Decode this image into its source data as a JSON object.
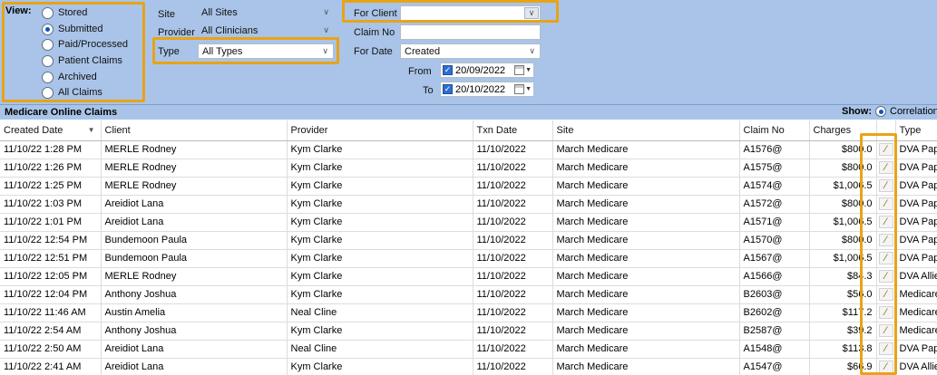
{
  "view": {
    "label": "View:",
    "options": [
      "Stored",
      "Submitted",
      "Paid/Processed",
      "Patient Claims",
      "Archived",
      "All Claims"
    ],
    "selected": "Submitted"
  },
  "filters": {
    "site_label": "Site",
    "site_value": "All Sites",
    "provider_label": "Provider",
    "provider_value": "All Clinicians",
    "type_label": "Type",
    "type_value": "All Types",
    "for_client_label": "For Client",
    "for_client_value": "",
    "claim_no_label": "Claim No",
    "claim_no_value": "",
    "for_date_label": "For Date",
    "for_date_value": "Created",
    "from_label": "From",
    "from_value": "20/09/2022",
    "to_label": "To",
    "to_value": "20/10/2022"
  },
  "section": {
    "title": "Medicare Online Claims",
    "show_label": "Show:",
    "show_option": "Correlation"
  },
  "table": {
    "columns": [
      "Created Date",
      "Client",
      "Provider",
      "Txn Date",
      "Site",
      "Claim No",
      "Charges",
      "",
      "Type"
    ],
    "rows": [
      [
        "11/10/22 1:28 PM",
        "MERLE Rodney",
        "Kym Clarke",
        "11/10/2022",
        "March Medicare",
        "A1576@",
        "$800.0",
        "DVA Pape"
      ],
      [
        "11/10/22 1:26 PM",
        "MERLE Rodney",
        "Kym Clarke",
        "11/10/2022",
        "March Medicare",
        "A1575@",
        "$800.0",
        "DVA Pape"
      ],
      [
        "11/10/22 1:25 PM",
        "MERLE Rodney",
        "Kym Clarke",
        "11/10/2022",
        "March Medicare",
        "A1574@",
        "$1,006.5",
        "DVA Pape"
      ],
      [
        "11/10/22 1:03 PM",
        "Areidiot Lana",
        "Kym Clarke",
        "11/10/2022",
        "March Medicare",
        "A1572@",
        "$800.0",
        "DVA Pape"
      ],
      [
        "11/10/22 1:01 PM",
        "Areidiot Lana",
        "Kym Clarke",
        "11/10/2022",
        "March Medicare",
        "A1571@",
        "$1,006.5",
        "DVA Pape"
      ],
      [
        "11/10/22 12:54 PM",
        "Bundemoon Paula",
        "Kym Clarke",
        "11/10/2022",
        "March Medicare",
        "A1570@",
        "$800.0",
        "DVA Pape"
      ],
      [
        "11/10/22 12:51 PM",
        "Bundemoon Paula",
        "Kym Clarke",
        "11/10/2022",
        "March Medicare",
        "A1567@",
        "$1,006.5",
        "DVA Pape"
      ],
      [
        "11/10/22 12:05 PM",
        "MERLE Rodney",
        "Kym Clarke",
        "11/10/2022",
        "March Medicare",
        "A1566@",
        "$84.3",
        "DVA Allied"
      ],
      [
        "11/10/22 12:04 PM",
        "Anthony Joshua",
        "Kym Clarke",
        "11/10/2022",
        "March Medicare",
        "B2603@",
        "$56.0",
        "Medicare"
      ],
      [
        "11/10/22 11:46 AM",
        "Austin Amelia",
        "Neal Cline",
        "11/10/2022",
        "March Medicare",
        "B2602@",
        "$117.2",
        "Medicare"
      ],
      [
        "11/10/22 2:54 AM",
        "Anthony Joshua",
        "Kym Clarke",
        "11/10/2022",
        "March Medicare",
        "B2587@",
        "$39.2",
        "Medicare"
      ],
      [
        "11/10/22 2:50 AM",
        "Areidiot Lana",
        "Neal Cline",
        "11/10/2022",
        "March Medicare",
        "A1548@",
        "$113.8",
        "DVA Pape"
      ],
      [
        "11/10/22 2:41 AM",
        "Areidiot Lana",
        "Kym Clarke",
        "11/10/2022",
        "March Medicare",
        "A1547@",
        "$66.9",
        "DVA Allied"
      ]
    ]
  },
  "colors": {
    "header_bg": "#a9c4e8",
    "highlight": "#e8a317",
    "radio_selected": "#0b57c5"
  }
}
